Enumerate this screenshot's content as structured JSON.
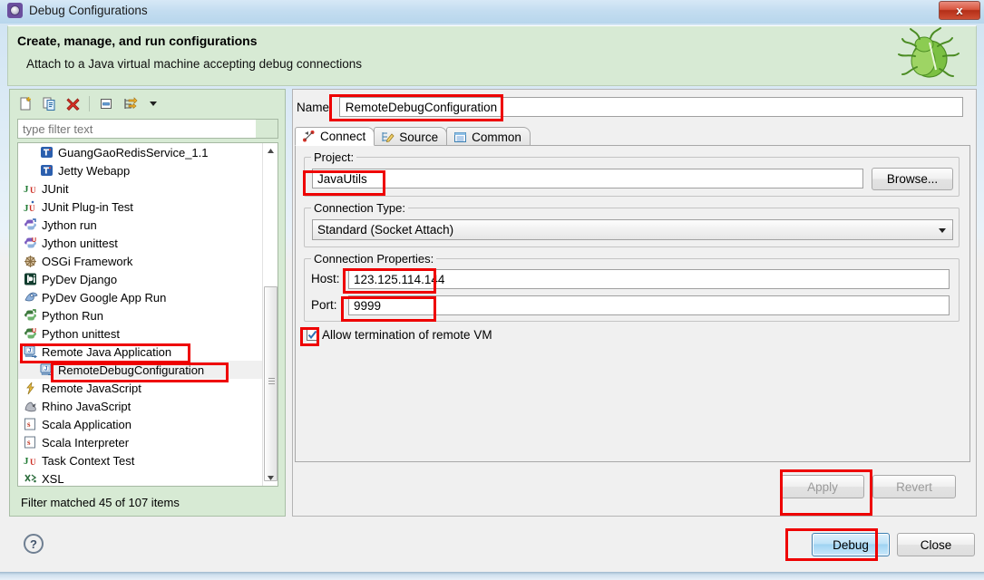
{
  "window": {
    "title": "Debug Configurations",
    "app_icon": "debug-gear-icon",
    "close_label": "x"
  },
  "header": {
    "title": "Create, manage, and run configurations",
    "subtitle": "Attach to a Java virtual machine accepting debug connections",
    "graphic": "green-bug-icon"
  },
  "toolbar": {
    "items": [
      {
        "name": "new-configuration-icon",
        "tooltip": "New launch configuration"
      },
      {
        "name": "duplicate-configuration-icon",
        "tooltip": "Duplicate"
      },
      {
        "name": "delete-configuration-icon",
        "tooltip": "Delete"
      },
      {
        "name": "collapse-all-icon",
        "tooltip": "Collapse All"
      },
      {
        "name": "filter-launch-configurations-icon",
        "tooltip": "Filter"
      },
      {
        "name": "chevron-down-icon",
        "tooltip": "View Menu"
      }
    ]
  },
  "filter": {
    "placeholder": "type filter text",
    "value": "",
    "status": "Filter matched 45 of 107 items"
  },
  "tree": {
    "items": [
      {
        "label": "GuangGaoRedisService_1.1",
        "icon": "jetty-config-icon",
        "indent": 2,
        "selected": false
      },
      {
        "label": "Jetty Webapp",
        "icon": "jetty-config-icon",
        "indent": 2,
        "selected": false
      },
      {
        "label": "JUnit",
        "icon": "junit-icon",
        "indent": 1,
        "selected": false
      },
      {
        "label": "JUnit Plug-in Test",
        "icon": "junit-plugin-icon",
        "indent": 1,
        "selected": false
      },
      {
        "label": "Jython run",
        "icon": "jython-run-icon",
        "indent": 1,
        "selected": false
      },
      {
        "label": "Jython unittest",
        "icon": "jython-unittest-icon",
        "indent": 1,
        "selected": false
      },
      {
        "label": "OSGi Framework",
        "icon": "osgi-icon",
        "indent": 1,
        "selected": false
      },
      {
        "label": "PyDev Django",
        "icon": "django-icon",
        "indent": 1,
        "selected": false
      },
      {
        "label": "PyDev Google App Run",
        "icon": "google-app-icon",
        "indent": 1,
        "selected": false
      },
      {
        "label": "Python Run",
        "icon": "python-run-icon",
        "indent": 1,
        "selected": false
      },
      {
        "label": "Python unittest",
        "icon": "python-unittest-icon",
        "indent": 1,
        "selected": false
      },
      {
        "label": "Remote Java Application",
        "icon": "remote-java-icon",
        "indent": 1,
        "selected": false
      },
      {
        "label": "RemoteDebugConfiguration",
        "icon": "remote-java-icon",
        "indent": 2,
        "selected": true
      },
      {
        "label": "Remote JavaScript",
        "icon": "remote-javascript-icon",
        "indent": 1,
        "selected": false
      },
      {
        "label": "Rhino JavaScript",
        "icon": "rhino-icon",
        "indent": 1,
        "selected": false
      },
      {
        "label": "Scala Application",
        "icon": "scala-icon",
        "indent": 1,
        "selected": false
      },
      {
        "label": "Scala Interpreter",
        "icon": "scala-icon",
        "indent": 1,
        "selected": false
      },
      {
        "label": "Task Context Test",
        "icon": "junit-icon",
        "indent": 1,
        "selected": false
      },
      {
        "label": "XSL",
        "icon": "xsl-icon",
        "indent": 1,
        "selected": false
      }
    ]
  },
  "config": {
    "name_label": "Name:",
    "name_value": "RemoteDebugConfiguration",
    "tabs": [
      {
        "label": "Connect",
        "icon": "connect-icon",
        "active": true
      },
      {
        "label": "Source",
        "icon": "source-icon",
        "active": false
      },
      {
        "label": "Common",
        "icon": "common-icon",
        "active": false
      }
    ],
    "project": {
      "group_label": "Project:",
      "value": "JavaUtils",
      "browse_label": "Browse..."
    },
    "connection_type": {
      "group_label": "Connection Type:",
      "selected": "Standard (Socket Attach)"
    },
    "connection_properties": {
      "group_label": "Connection Properties:",
      "host_label": "Host:",
      "host_value": "123.125.114.144",
      "port_label": "Port:",
      "port_value": "9999"
    },
    "allow_termination": {
      "label": "Allow termination of remote VM",
      "checked": true
    }
  },
  "buttons": {
    "apply": "Apply",
    "revert": "Revert",
    "debug": "Debug",
    "close": "Close",
    "help": "?"
  },
  "colors": {
    "header_bg": "#d7ead4",
    "annotation": "#ee0000",
    "panel_bg": "#f0f0f0",
    "default_button": "#9fd3f2"
  }
}
